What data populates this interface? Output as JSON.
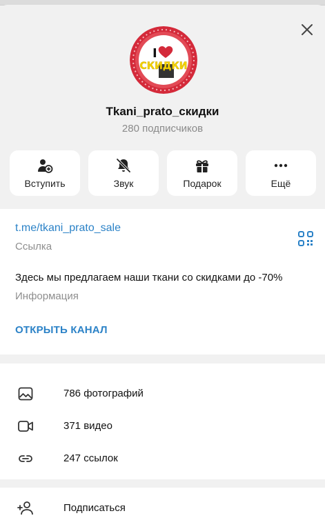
{
  "channel": {
    "name": "Tkani_prato_скидки",
    "subscribers": "280 подписчиков",
    "avatar_text_top": "I",
    "avatar_text_bottom": "СКИДКИ"
  },
  "actions": [
    {
      "label": "Вступить",
      "icon": "add-user-icon"
    },
    {
      "label": "Звук",
      "icon": "bell-off-icon"
    },
    {
      "label": "Подарок",
      "icon": "gift-icon"
    },
    {
      "label": "Ещё",
      "icon": "more-icon"
    }
  ],
  "info": {
    "link": "t.me/tkani_prato_sale",
    "link_label": "Ссылка",
    "description": "Здесь мы предлагаем наши ткани со скидками до -70%",
    "description_label": "Информация",
    "open_channel": "ОТКРЫТЬ КАНАЛ"
  },
  "media": [
    {
      "label": "786 фотографий",
      "icon": "photo-icon"
    },
    {
      "label": "371 видео",
      "icon": "video-icon"
    },
    {
      "label": "247 ссылок",
      "icon": "link-icon"
    }
  ],
  "subscribe": {
    "label": "Подписаться",
    "icon": "add-person-icon"
  },
  "colors": {
    "accent": "#2b82c7",
    "avatar_red": "#d42a3a",
    "avatar_yellow": "#f5d200"
  }
}
